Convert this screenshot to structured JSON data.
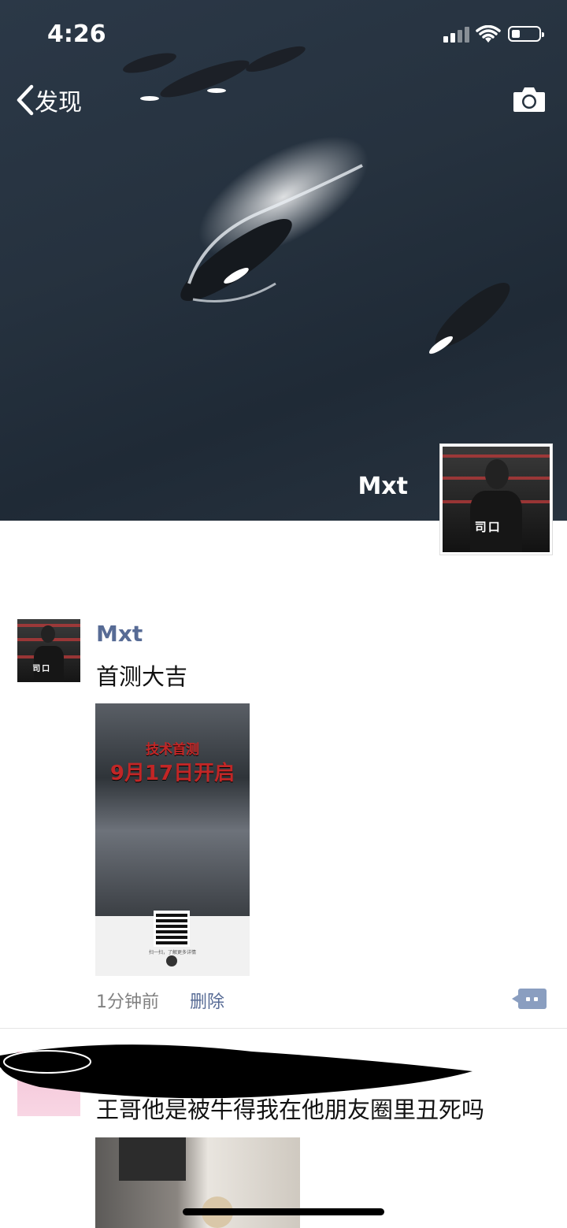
{
  "status_bar": {
    "time": "4:26"
  },
  "nav": {
    "back_label": "发现",
    "back_icon": "chevron-left-icon",
    "camera_icon": "camera-icon"
  },
  "cover": {
    "username": "Mxt"
  },
  "posts": [
    {
      "author": "Mxt",
      "text": "首测大吉",
      "poster": {
        "headline_top": "技术首测",
        "headline_main": "9月17日开启",
        "caption": "扫一扫，了解更多详情"
      },
      "time": "1分钟前",
      "delete_label": "删除"
    },
    {
      "author": "",
      "text": "王哥他是被牛得我在他朋友圈里丑死吗"
    }
  ],
  "colors": {
    "link": "#576b95",
    "meta": "#808080",
    "cover_bg": "#26323f"
  }
}
